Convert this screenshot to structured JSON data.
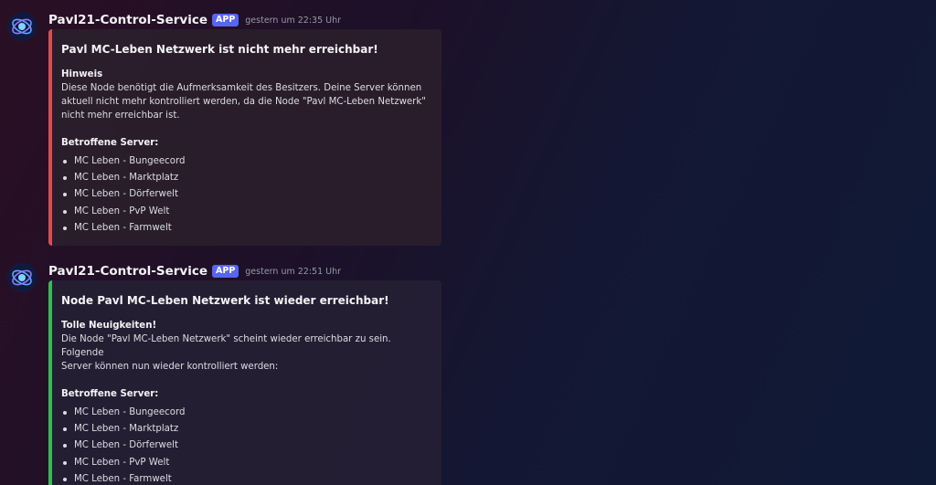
{
  "messages": [
    {
      "username": "Pavl21-Control-Service",
      "badge": "APP",
      "timestamp": "gestern um 22:35 Uhr",
      "accent_color": "#e24b4b",
      "embed": {
        "title": "Pavl MC-Leben Netzwerk ist nicht mehr erreichbar!",
        "field_name": "Hinweis",
        "field_value": "Diese Node benötigt die Aufmerksamkeit des Besitzers. Deine Server können\naktuell nicht mehr kontrolliert werden, da die Node \"Pavl MC-Leben Netzwerk\"\nnicht mehr erreichbar ist.",
        "servers_heading": "Betroffene Server:",
        "servers": [
          "MC Leben - Bungeecord",
          "MC Leben - Marktplatz",
          "MC Leben - Dörferwelt",
          "MC Leben - PvP Welt",
          "MC Leben - Farmwelt"
        ]
      }
    },
    {
      "username": "Pavl21-Control-Service",
      "badge": "APP",
      "timestamp": "gestern um 22:51 Uhr",
      "accent_color": "#2fbf4e",
      "embed": {
        "title": "Node Pavl MC-Leben Netzwerk ist wieder erreichbar!",
        "field_name": "Tolle Neuigkeiten!",
        "field_value": "Die Node \"Pavl MC-Leben Netzwerk\" scheint wieder erreichbar zu sein. Folgende\nServer können nun wieder kontrolliert werden:",
        "servers_heading": "Betroffene Server:",
        "servers": [
          "MC Leben - Bungeecord",
          "MC Leben - Marktplatz",
          "MC Leben - Dörferwelt",
          "MC Leben - PvP Welt",
          "MC Leben - Farmwelt"
        ]
      }
    }
  ],
  "icons": {
    "avatar": "bot-avatar-icon"
  }
}
